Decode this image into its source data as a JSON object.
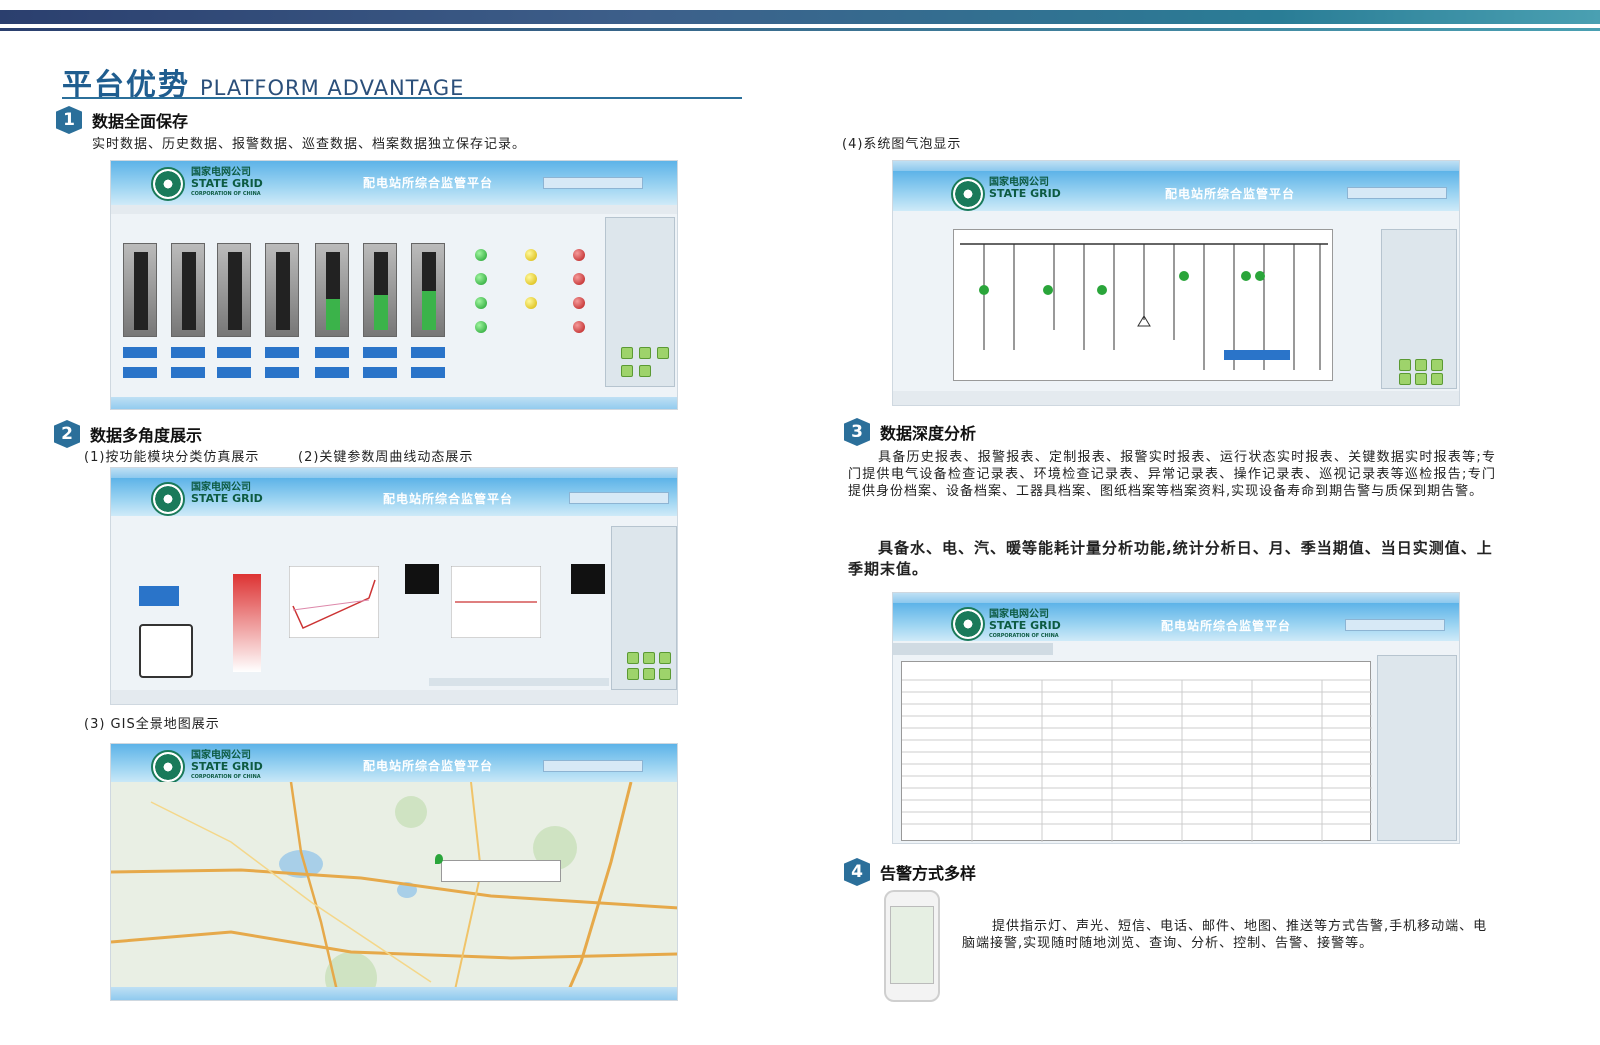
{
  "header": {
    "title_cn": "平台优势",
    "title_en": "PLATFORM ADVANTAGE"
  },
  "section1": {
    "num": "1",
    "heading": "数据全面保存",
    "desc": "实时数据、历史数据、报警数据、巡查数据、档案数据独立保存记录。"
  },
  "section2": {
    "num": "2",
    "heading": "数据多角度展示",
    "sub1": "(1)按功能模块分类仿真展示",
    "sub2": "(2)关键参数周曲线动态展示",
    "sub3": "(3) GIS全景地图展示"
  },
  "section_r": {
    "sub4": "(4)系统图气泡显示"
  },
  "section3": {
    "num": "3",
    "heading": "数据深度分析",
    "p1": "具备历史报表、报警报表、定制报表、报警实时报表、运行状态实时报表、关键数据实时报表等;专门提供电气设备检查记录表、环境检查记录表、异常记录表、操作记录表、巡视记录表等巡检报告;专门提供身份档案、设备档案、工器具档案、图纸档案等档案资料,实现设备寿命到期告警与质保到期告警。",
    "p2": "具备水、电、汽、暖等能耗计量分析功能,统计分析日、月、季当期值、当日实测值、上季期末值。"
  },
  "section4": {
    "num": "4",
    "heading": "告警方式多样",
    "desc": "提供指示灯、声光、短信、电话、邮件、地图、推送等方式告警,手机移动端、电脑端接警,实现随时随地浏览、查询、分析、控制、告警、接警等。"
  },
  "app": {
    "logo_cn": "国家电网公司",
    "logo_en": "STATE GRID",
    "logo_sub": "CORPORATION OF CHINA",
    "title": "配电站所综合监管平台"
  },
  "colors": {
    "accent": "#2b6f9a",
    "brand_green": "#0d5b42",
    "header_blue": "#5db3e8"
  }
}
